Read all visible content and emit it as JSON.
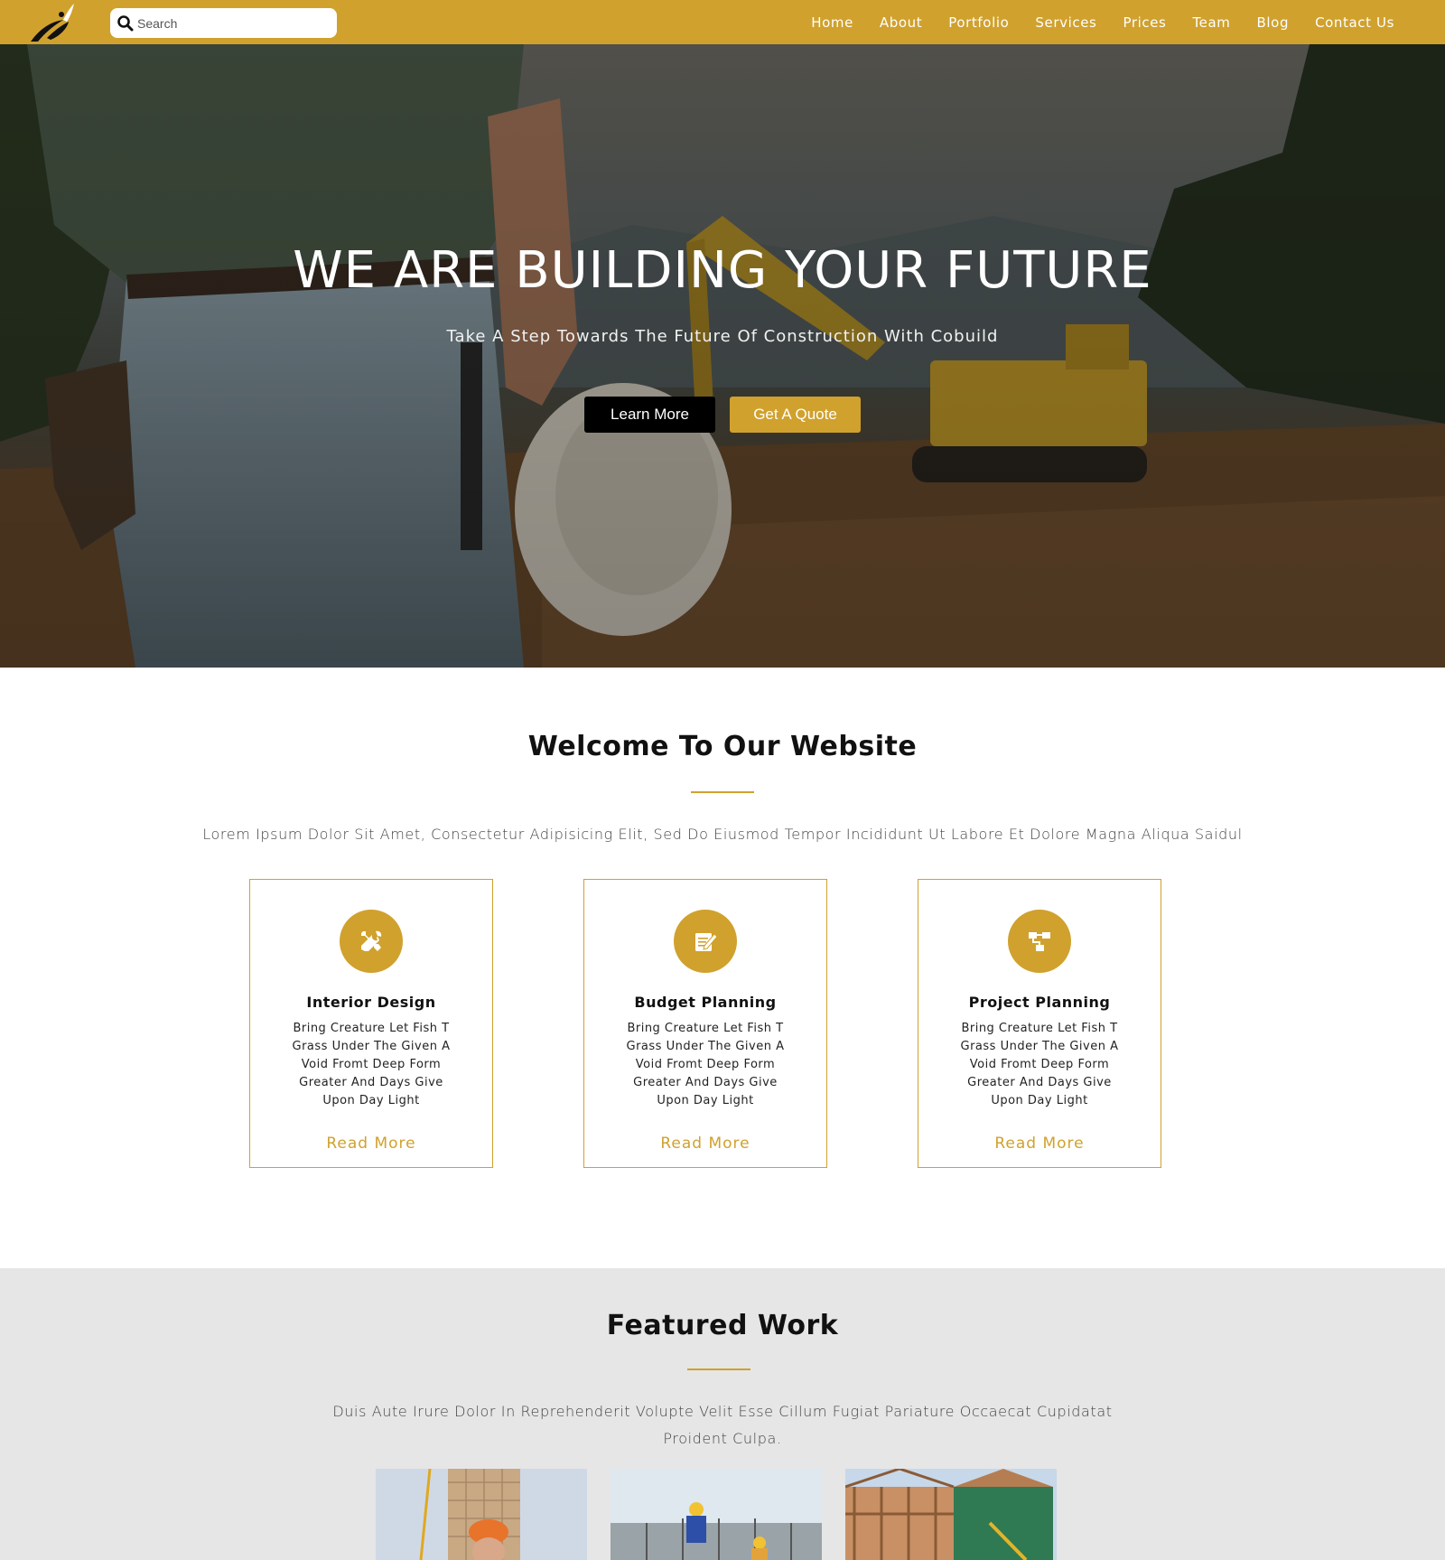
{
  "nav": {
    "search_placeholder": "Search",
    "links": [
      "Home",
      "About",
      "Portfolio",
      "Services",
      "Prices",
      "Team",
      "Blog",
      "Contact Us"
    ]
  },
  "hero": {
    "title": "WE ARE BUILDING YOUR FUTURE",
    "subtitle": "Take A Step Towards The Future Of Construction With Cobuild",
    "learn_more": "Learn More",
    "get_quote": "Get A Quote"
  },
  "welcome": {
    "title": "Welcome To Our Website",
    "text": "Lorem Ipsum Dolor Sit Amet, Consectetur Adipisicing Elit, Sed Do Eiusmod Tempor Incididunt Ut Labore Et Dolore Magna Aliqua Saidul",
    "cards": [
      {
        "icon": "tools-icon",
        "title": "Interior Design",
        "text": "Bring Creature Let Fish T Grass Under The Given A Void Fromt Deep Form Greater And Days Give Upon Day Light",
        "link": "Read More"
      },
      {
        "icon": "edit-icon",
        "title": "Budget Planning",
        "text": "Bring Creature Let Fish T Grass Under The Given A Void Fromt Deep Form Greater And Days Give Upon Day Light",
        "link": "Read More"
      },
      {
        "icon": "sitemap-icon",
        "title": "Project Planning",
        "text": "Bring Creature Let Fish T Grass Under The Given A Void Fromt Deep Form Greater And Days Give Upon Day Light",
        "link": "Read More"
      }
    ]
  },
  "featured": {
    "title": "Featured Work",
    "text": "Duis Aute Irure Dolor In Reprehenderit Volupte Velit Esse Cillum Fugiat Pariature Occaecat Cupidatat Proident Culpa."
  },
  "colors": {
    "brand_gold": "#d0a12d",
    "dark_button": "#000000",
    "featured_bg": "#e6e6e6"
  }
}
